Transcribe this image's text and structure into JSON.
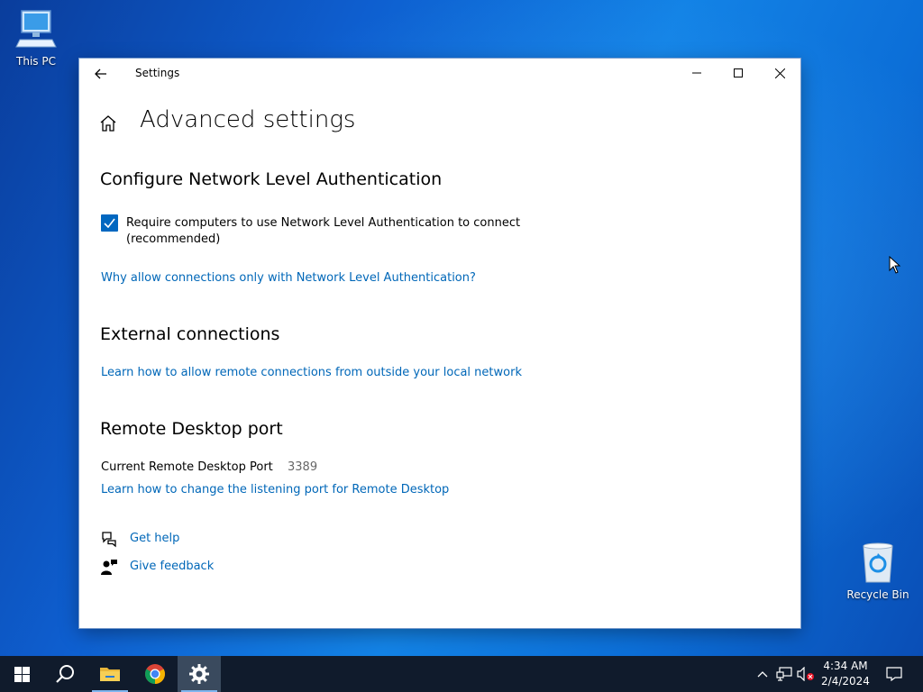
{
  "desktop": {
    "icons": [
      {
        "label": "This PC",
        "icon": "computer-icon"
      },
      {
        "label": "Recycle Bin",
        "icon": "recycle-bin-icon"
      }
    ]
  },
  "window": {
    "title": "Settings",
    "back_icon": "back-arrow-icon",
    "controls": [
      "minimize",
      "maximize",
      "close"
    ]
  },
  "page": {
    "title": "Advanced settings",
    "home_icon": "home-icon",
    "sections": {
      "nla": {
        "heading": "Configure Network Level Authentication",
        "checkbox_label": "Require computers to use Network Level Authentication to connect (recommended)",
        "checkbox_checked": true,
        "link": "Why allow connections only with Network Level Authentication?"
      },
      "external": {
        "heading": "External connections",
        "link": "Learn how to allow remote connections from outside your local network"
      },
      "port": {
        "heading": "Remote Desktop port",
        "label": "Current Remote Desktop Port",
        "value": "3389",
        "link": "Learn how to change the listening port for Remote Desktop"
      }
    },
    "help": {
      "get_help": "Get help",
      "give_feedback": "Give feedback"
    }
  },
  "taskbar": {
    "buttons": [
      "start",
      "search",
      "file-explorer",
      "chrome",
      "settings"
    ],
    "active": "settings",
    "clock": {
      "time": "4:34 AM",
      "date": "2/4/2024"
    }
  },
  "colors": {
    "accent": "#0067c0",
    "link": "#0067b8",
    "taskbar": "#101b2c"
  }
}
